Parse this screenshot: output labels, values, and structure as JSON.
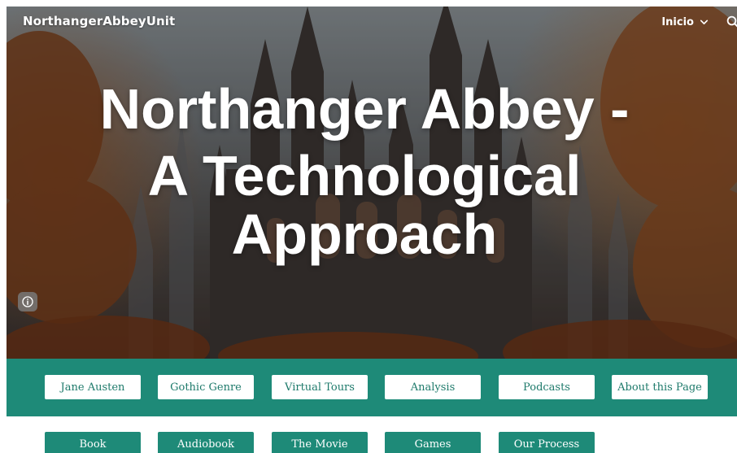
{
  "site": {
    "name": "NorthangerAbbeyUnit"
  },
  "nav": {
    "inicio_label": "Inicio",
    "search_icon": "search-icon",
    "chevron_icon": "chevron-down-icon"
  },
  "hero": {
    "title_line1": "Northanger Abbey -",
    "title_line2": "A Technological",
    "title_line3": "Approach",
    "info_icon": "info-icon"
  },
  "nav_buttons_row1": [
    {
      "label": "Jane Austen"
    },
    {
      "label": "Gothic Genre"
    },
    {
      "label": "Virtual Tours"
    },
    {
      "label": "Analysis"
    },
    {
      "label": "Podcasts"
    },
    {
      "label": "About this Page"
    }
  ],
  "nav_buttons_row2": [
    {
      "label": "Book"
    },
    {
      "label": "Audiobook"
    },
    {
      "label": "The Movie"
    },
    {
      "label": "Games"
    },
    {
      "label": "Our Process"
    }
  ],
  "colors": {
    "accent": "#1e8a78",
    "button_text": "#1e7a6b",
    "white": "#ffffff"
  }
}
